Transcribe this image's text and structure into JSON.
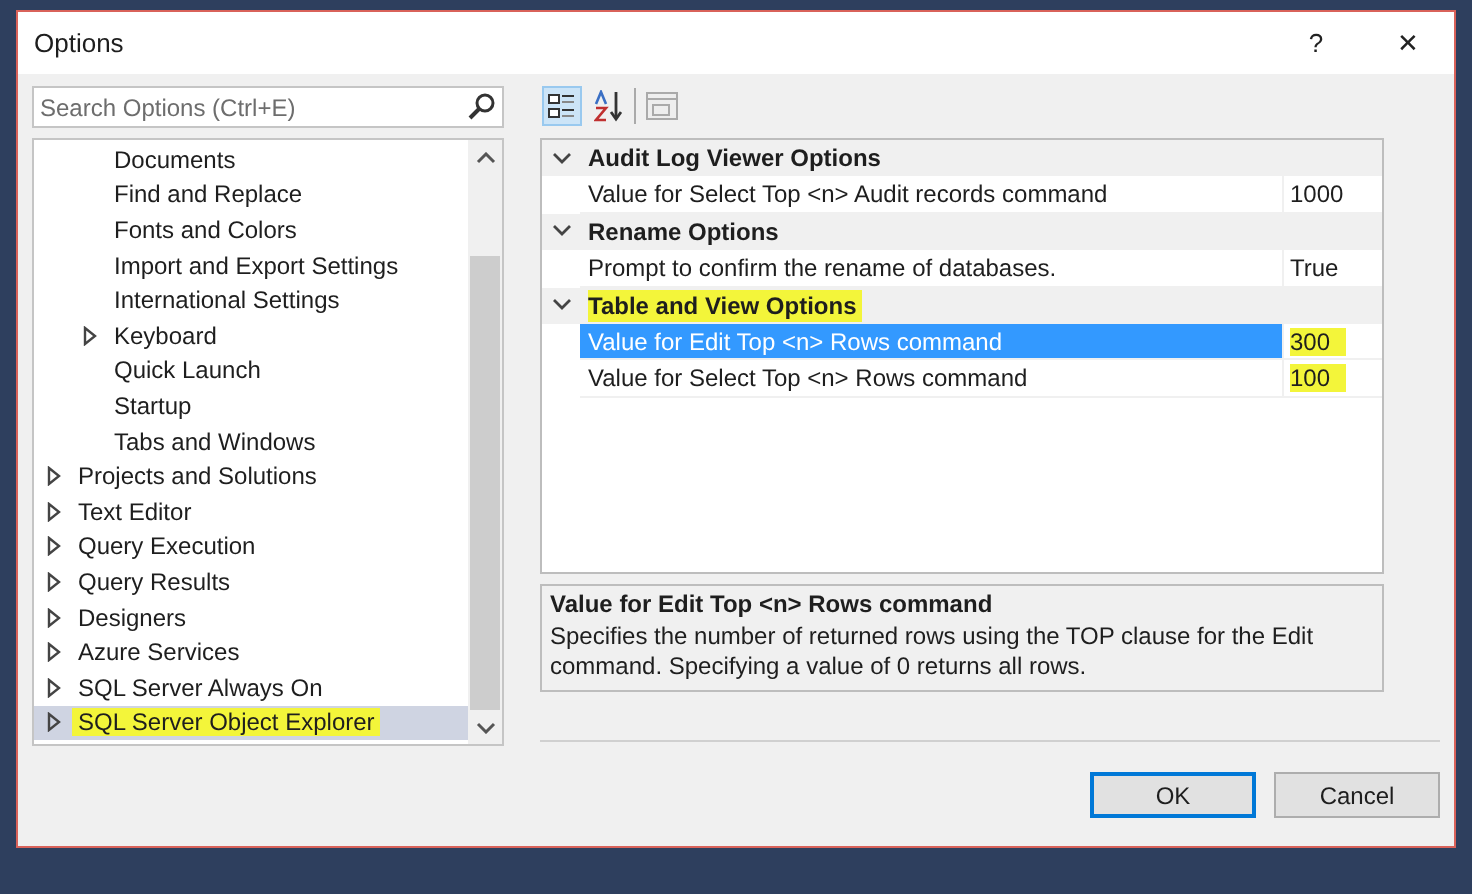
{
  "window": {
    "title": "Options",
    "help": "?",
    "close": "✕"
  },
  "search": {
    "placeholder": "Search Options (Ctrl+E)"
  },
  "tree": {
    "items": [
      {
        "kind": "group",
        "children": [
          {
            "label": "Documents",
            "kind": "leaf",
            "selected": false,
            "highlighted": false
          },
          {
            "label": "Find and Replace",
            "kind": "leaf",
            "selected": false,
            "highlighted": false
          },
          {
            "label": "Fonts and Colors",
            "kind": "leaf",
            "selected": false,
            "highlighted": false
          },
          {
            "label": "Import and Export Settings",
            "kind": "leaf",
            "selected": false,
            "highlighted": false
          },
          {
            "label": "International Settings",
            "kind": "leaf",
            "selected": false,
            "highlighted": false
          },
          {
            "label": "Keyboard",
            "kind": "collapsed",
            "selected": false,
            "highlighted": false
          },
          {
            "label": "Quick Launch",
            "kind": "leaf",
            "selected": false,
            "highlighted": false
          },
          {
            "label": "Startup",
            "kind": "leaf",
            "selected": false,
            "highlighted": false
          },
          {
            "label": "Tabs and Windows",
            "kind": "leaf",
            "selected": false,
            "highlighted": false
          }
        ]
      },
      {
        "label": "Projects and Solutions",
        "kind": "collapsed",
        "selected": false,
        "highlighted": false
      },
      {
        "label": "Text Editor",
        "kind": "collapsed",
        "selected": false,
        "highlighted": false
      },
      {
        "label": "Query Execution",
        "kind": "collapsed",
        "selected": false,
        "highlighted": false
      },
      {
        "label": "Query Results",
        "kind": "collapsed",
        "selected": false,
        "highlighted": false
      },
      {
        "label": "Designers",
        "kind": "collapsed",
        "selected": false,
        "highlighted": false
      },
      {
        "label": "Azure Services",
        "kind": "collapsed",
        "selected": false,
        "highlighted": false
      },
      {
        "label": "SQL Server Always On",
        "kind": "collapsed",
        "selected": false,
        "highlighted": false
      },
      {
        "label": "SQL Server Object Explorer",
        "kind": "collapsed",
        "selected": true,
        "highlighted": true
      }
    ]
  },
  "toolbar": [
    {
      "kind": "categorized",
      "selected": true,
      "disabled": false
    },
    {
      "kind": "alphabetical",
      "selected": false,
      "disabled": false
    },
    {
      "kind": "property-pages",
      "selected": false,
      "disabled": true
    }
  ],
  "property_grid": {
    "categories": [
      {
        "label": "Audit Log Viewer Options",
        "expanded": true,
        "highlighted": false,
        "properties": [
          {
            "name": "Value for Select Top <n> Audit records command",
            "value": "1000",
            "selected": false,
            "highlighted": false
          }
        ]
      },
      {
        "label": "Rename Options",
        "expanded": true,
        "highlighted": false,
        "properties": [
          {
            "name": "Prompt to confirm the rename of databases.",
            "value": "True",
            "selected": false,
            "highlighted": false
          }
        ]
      },
      {
        "label": "Table and View Options",
        "expanded": true,
        "highlighted": true,
        "properties": [
          {
            "name": "Value for Edit Top <n> Rows command",
            "value": "300",
            "selected": true,
            "highlighted": true
          },
          {
            "name": "Value for Select Top <n> Rows command",
            "value": "100",
            "selected": false,
            "highlighted": true
          }
        ]
      }
    ]
  },
  "description": {
    "title": "Value for Edit Top <n> Rows command",
    "text": "Specifies the number of returned rows using the TOP clause for the Edit command. Specifying a value of 0 returns all rows."
  },
  "buttons": [
    {
      "label": "OK",
      "default": true
    },
    {
      "label": "Cancel",
      "default": false
    }
  ]
}
